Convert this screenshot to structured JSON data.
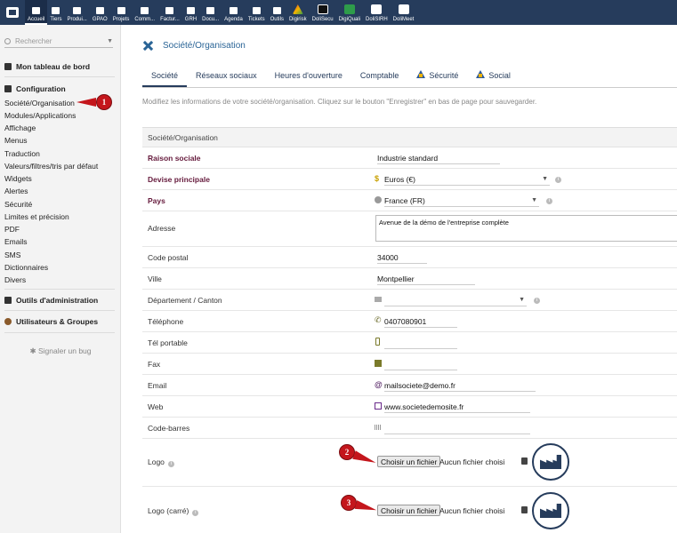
{
  "topnav": [
    {
      "label": "Accueil",
      "icon": "home-icon",
      "active": true
    },
    {
      "label": "Tiers",
      "icon": "building-icon"
    },
    {
      "label": "Produi...",
      "icon": "cube-icon"
    },
    {
      "label": "GPAO",
      "icon": "cubes-icon"
    },
    {
      "label": "Projets",
      "icon": "project-icon"
    },
    {
      "label": "Comm...",
      "icon": "commerce-icon"
    },
    {
      "label": "Factur...",
      "icon": "invoice-icon"
    },
    {
      "label": "GRH",
      "icon": "hrm-icon"
    },
    {
      "label": "Docu...",
      "icon": "folder-icon"
    },
    {
      "label": "Agenda",
      "icon": "calendar-icon"
    },
    {
      "label": "Tickets",
      "icon": "ticket-icon"
    },
    {
      "label": "Outils",
      "icon": "tools-icon"
    },
    {
      "label": "Digirisk",
      "icon": "digirisk-icon"
    },
    {
      "label": "DoliSecu",
      "icon": "lock-icon"
    },
    {
      "label": "DigiQuali",
      "icon": "digiquali-icon"
    },
    {
      "label": "DoliSIRH",
      "icon": "dolisirh-icon"
    },
    {
      "label": "DoliMeet",
      "icon": "dolimeet-icon"
    }
  ],
  "sidebar": {
    "search_placeholder": "Rechercher",
    "dashboard": "Mon tableau de bord",
    "config_title": "Configuration",
    "config_items": [
      "Société/Organisation",
      "Modules/Applications",
      "Affichage",
      "Menus",
      "Traduction",
      "Valeurs/filtres/tris par défaut",
      "Widgets",
      "Alertes",
      "Sécurité",
      "Limites et précision",
      "PDF",
      "Emails",
      "SMS",
      "Dictionnaires",
      "Divers"
    ],
    "admin_tools": "Outils d'administration",
    "users_groups": "Utilisateurs & Groupes",
    "bug_report": "Signaler un bug"
  },
  "page": {
    "title": "Société/Organisation",
    "tabs": [
      "Société",
      "Réseaux sociaux",
      "Heures d'ouverture",
      "Comptable",
      "Sécurité",
      "Social"
    ],
    "active_tab": "Société",
    "intro": "Modifiez les informations de votre société/organisation. Cliquez sur le bouton \"Enregistrer\" en bas de page pour sauvegarder.",
    "section_title": "Société/Organisation"
  },
  "form": {
    "raison_sociale": {
      "label": "Raison sociale",
      "value": "Industrie standard"
    },
    "devise": {
      "label": "Devise principale",
      "value": "Euros (€)",
      "icon": "$"
    },
    "pays": {
      "label": "Pays",
      "value": "France (FR)"
    },
    "adresse": {
      "label": "Adresse",
      "value": "Avenue de la démo de l'entreprise complète"
    },
    "code_postal": {
      "label": "Code postal",
      "value": "34000"
    },
    "ville": {
      "label": "Ville",
      "value": "Montpellier"
    },
    "departement": {
      "label": "Département / Canton",
      "value": ""
    },
    "telephone": {
      "label": "Téléphone",
      "value": "0407080901"
    },
    "tel_portable": {
      "label": "Tél portable",
      "value": ""
    },
    "fax": {
      "label": "Fax",
      "value": ""
    },
    "email": {
      "label": "Email",
      "value": "mailsociete@demo.fr",
      "icon": "@"
    },
    "web": {
      "label": "Web",
      "value": "www.societedemosite.fr"
    },
    "code_barres": {
      "label": "Code-barres",
      "value": ""
    },
    "logo": {
      "label": "Logo",
      "button": "Choisir un fichier",
      "file_text": "Aucun fichier choisi"
    },
    "logo_carre": {
      "label": "Logo (carré)",
      "button": "Choisir un fichier",
      "file_text": "Aucun fichier choisi"
    }
  },
  "callouts": [
    "1",
    "2",
    "3"
  ],
  "colors": {
    "topbar": "#263c5c",
    "callout": "#c4161c",
    "required_label": "#651a3c",
    "link": "#2a6496"
  }
}
